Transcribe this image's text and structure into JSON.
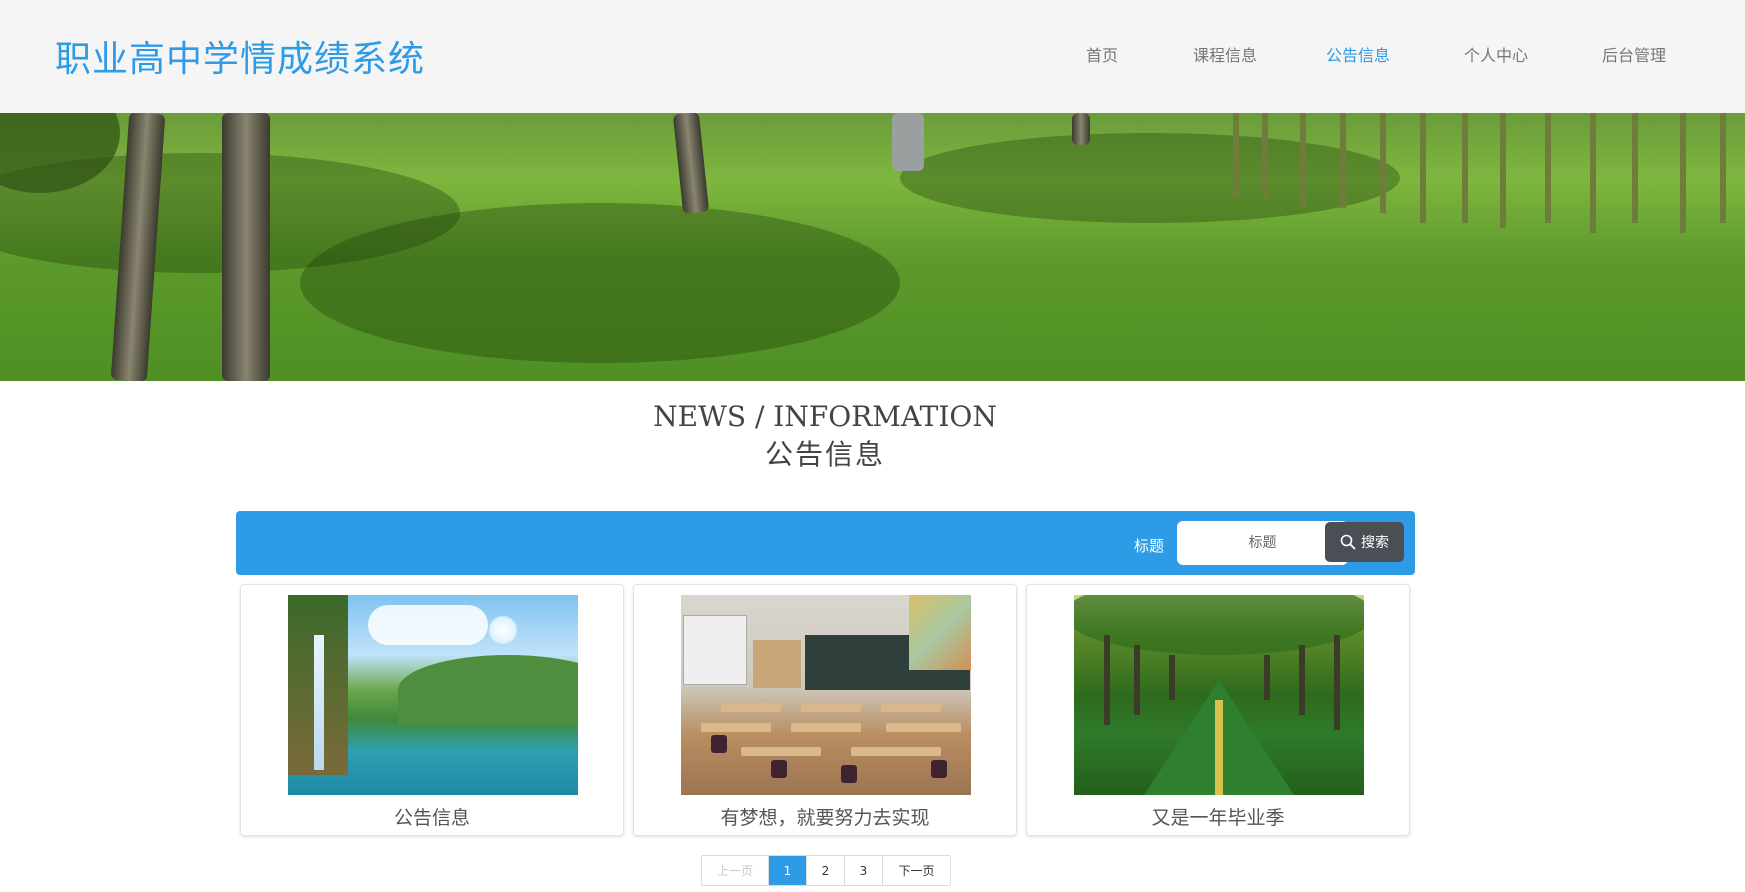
{
  "header": {
    "site_title": "职业高中学情成绩系统",
    "nav": [
      {
        "label": "首页",
        "active": false
      },
      {
        "label": "课程信息",
        "active": false
      },
      {
        "label": "公告信息",
        "active": true
      },
      {
        "label": "个人中心",
        "active": false
      },
      {
        "label": "后台管理",
        "active": false
      }
    ]
  },
  "section": {
    "title_en": "NEWS / INFORMATION",
    "title_cn": "公告信息"
  },
  "search": {
    "label": "标题",
    "placeholder": "标题",
    "value": "",
    "button_label": "搜索",
    "icon": "search-icon"
  },
  "cards": [
    {
      "title": "公告信息",
      "image": "waterfall-lake-image"
    },
    {
      "title": "有梦想，就要努力去实现",
      "image": "classroom-image"
    },
    {
      "title": "又是一年毕业季",
      "image": "tree-avenue-image"
    }
  ],
  "pagination": {
    "prev": "上一页",
    "pages": [
      "1",
      "2",
      "3"
    ],
    "current": "1",
    "next": "下一页"
  },
  "colors": {
    "accent": "#2d9be6",
    "header_bg": "#f5f5f5",
    "search_button": "#4a4f55"
  }
}
